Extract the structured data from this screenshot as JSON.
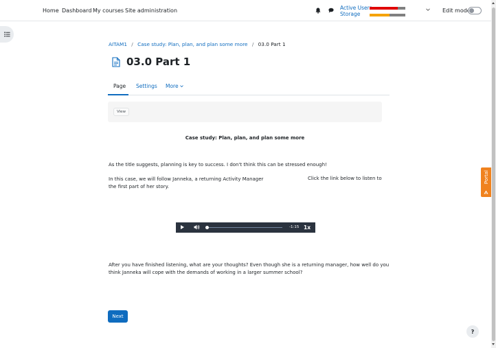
{
  "navbar": {
    "links": [
      "Home",
      "Dashboard",
      "My courses",
      "Site administration"
    ],
    "usage": {
      "active_users_label": "Active Users",
      "storage_label": "Storage",
      "active_users_fraction": 0.78,
      "storage_fraction": 0.55,
      "active_users_color": "#e00000",
      "storage_color": "#f5a300",
      "remainder_color": "#808080"
    },
    "edit_mode_label": "Edit mode",
    "edit_mode_on": false
  },
  "breadcrumb": {
    "items": [
      "AITAM1",
      "Case study: Plan, plan, and plan some more"
    ],
    "separator": "/",
    "current": "03.0 Part 1"
  },
  "page": {
    "title": "03.0 Part 1",
    "icon": "page-document-icon"
  },
  "tabs": {
    "page": "Page",
    "settings": "Settings",
    "more": "More"
  },
  "activity_header": {
    "view_label": "View"
  },
  "content": {
    "subtitle": "Case study: Plan, plan, and plan some more",
    "para1": "As the title suggests, planning is key to success. I don't think this can be stressed enough!",
    "para2_line1": "In this case, we will follow Janneka, a returning Activity Manager",
    "para2_line2": "the first part of her story.",
    "para2_right": "Click the link below to listen to",
    "para3_line1": "After you have finished listening, what are your thoughts? Even though she is a returning manager, how well do you",
    "para3_line2": "think Janneka will cope with the demands of working in a larger summer school?"
  },
  "player": {
    "time": "-1:15",
    "rate": "1x",
    "progress_fraction": 0.0
  },
  "next_label": "Next",
  "portal_label": "Portal",
  "help_label": "?",
  "colors": {
    "primary": "#0f6cbf",
    "portal": "#f0821e",
    "player_bg": "#2b333f"
  }
}
